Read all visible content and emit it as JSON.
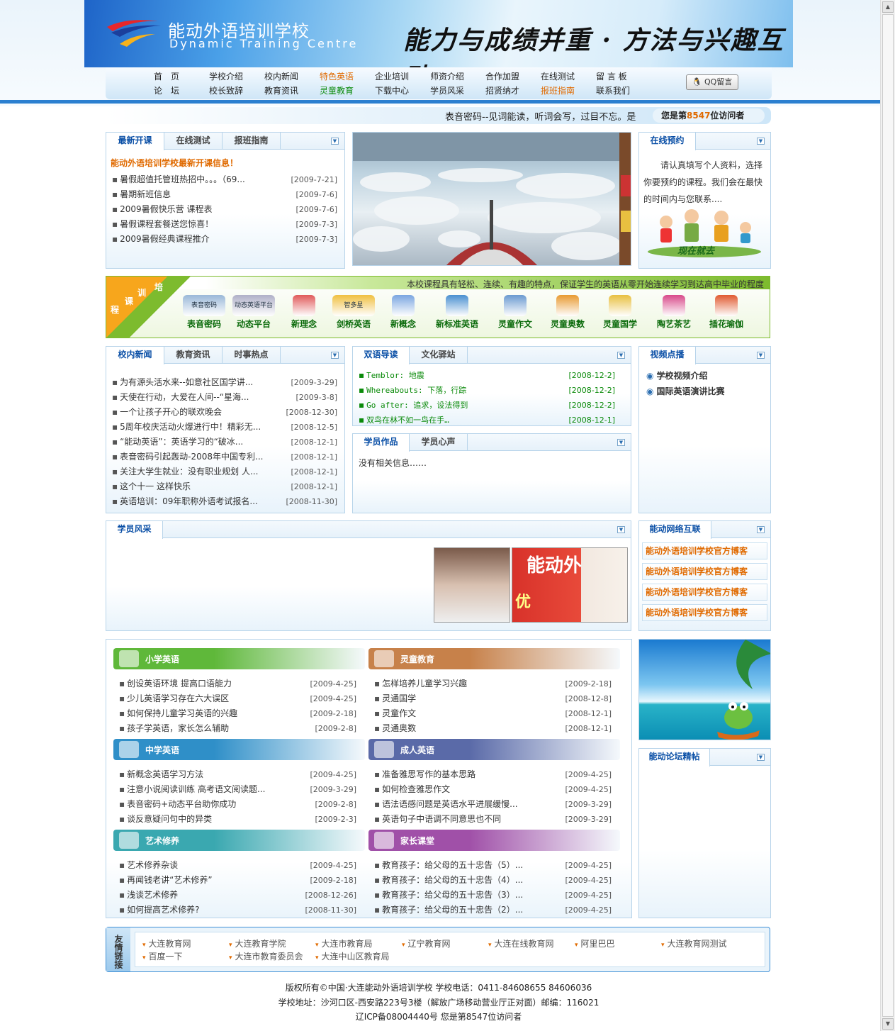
{
  "header": {
    "school_cn": "能动外语培训学校",
    "school_en": "Dynamic Training Centre",
    "slogan": "能力与成绩并重 · 方法与兴趣互动"
  },
  "nav": {
    "row1": [
      "首　页",
      "学校介绍",
      "校内新闻",
      "特色英语",
      "企业培训",
      "师资介绍",
      "合作加盟",
      "在线测试",
      "留 言 板"
    ],
    "row2": [
      "论　坛",
      "校长致辞",
      "教育资讯",
      "灵童教育",
      "下载中心",
      "学员风采",
      "招贤纳才",
      "报班指南",
      "联系我们"
    ],
    "qq": "QQ留言"
  },
  "ticker": {
    "text": "表音密码--见词能读，听词会写，过目不忘。是",
    "visitor_prefix": "您是第",
    "visitor_count": "8547",
    "visitor_suffix": "位访问者"
  },
  "newclass": {
    "tabs": [
      "最新开课",
      "在线测试",
      "报班指南"
    ],
    "headline": "能动外语培训学校最新开课信息！",
    "items": [
      {
        "t": "暑假超值托管班热招中。。。（69...",
        "d": "[2009-7-21]"
      },
      {
        "t": "暑期新班信息",
        "d": "[2009-7-6]"
      },
      {
        "t": "2009暑假快乐营 课程表",
        "d": "[2009-7-6]"
      },
      {
        "t": "暑假课程套餐送您惊喜！",
        "d": "[2009-7-3]"
      },
      {
        "t": "2009暑假经典课程推介",
        "d": "[2009-7-3]"
      }
    ]
  },
  "booking": {
    "tab": "在线预约",
    "text": "请认真填写个人资料，选择你要预约的课程。我们会在最快的时间内与您联系....",
    "img_text": "现在就去"
  },
  "courses": {
    "corner": [
      "培",
      "训",
      "课",
      "程"
    ],
    "desc": "本校课程具有轻松、连续、有趣的特点，保证学生的英语从零开始连续学习到达高中毕业的程度",
    "items": [
      "表音密码",
      "动态平台",
      "新理念",
      "剑桥英语",
      "新概念",
      "新标准英语",
      "灵童作文",
      "灵童奥数",
      "灵童国学",
      "陶艺茶艺",
      "插花瑜伽"
    ],
    "logo_texts": [
      "表音密码",
      "动态英语平台",
      "智多星"
    ]
  },
  "news": {
    "tabs": [
      "校内新闻",
      "教育资讯",
      "时事热点"
    ],
    "items": [
      {
        "t": "为有源头活水来--如意社区国学讲...",
        "d": "[2009-3-29]"
      },
      {
        "t": "天使在行动，大爱在人间--“星海...",
        "d": "[2009-3-8]"
      },
      {
        "t": "一个让孩子开心的联欢晚会",
        "d": "[2008-12-30]"
      },
      {
        "t": "5周年校庆活动火爆进行中！精彩无...",
        "d": "[2008-12-5]"
      },
      {
        "t": "“能动英语”：英语学习的“破冰...",
        "d": "[2008-12-1]"
      },
      {
        "t": "表音密码引起轰动-2008年中国专利...",
        "d": "[2008-12-1]"
      },
      {
        "t": "关注大学生就业：没有职业规划 人...",
        "d": "[2008-12-1]"
      },
      {
        "t": "这个十一 这样快乐",
        "d": "[2008-12-1]"
      },
      {
        "t": "英语培训：09年职称外语考试报名...",
        "d": "[2008-11-30]"
      }
    ]
  },
  "vocab": {
    "tabs": [
      "双语导读",
      "文化驿站"
    ],
    "items": [
      {
        "t": "Temblor: 地震",
        "d": "[2008-12-2]"
      },
      {
        "t": "Whereabouts: 下落，行踪",
        "d": "[2008-12-2]"
      },
      {
        "t": "Go after: 追求，设法得到",
        "d": "[2008-12-2]"
      },
      {
        "t": "双鸟在林不如一鸟在手…",
        "d": "[2008-12-1]"
      }
    ]
  },
  "works": {
    "tabs": [
      "学员作品",
      "学员心声"
    ],
    "empty": "没有相关信息……"
  },
  "video": {
    "tab": "视频点播",
    "items": [
      "学校视频介绍",
      "国际英语演讲比赛"
    ]
  },
  "students": {
    "tab": "学员风采",
    "photo_text": "能动外",
    "photo_text2": "优"
  },
  "network": {
    "tab": "能动网络互联",
    "items": [
      "能动外语培训学校官方博客",
      "能动外语培训学校官方博客",
      "能动外语培训学校官方博客",
      "能动外语培训学校官方博客"
    ]
  },
  "forum": {
    "tab": "能动论坛精帖"
  },
  "sections": [
    {
      "title": "小学英语",
      "color": "#5fb83a",
      "items": [
        {
          "t": "创设英语环境 提高口语能力",
          "d": "[2009-4-25]"
        },
        {
          "t": "少儿英语学习存在六大误区",
          "d": "[2009-4-25]"
        },
        {
          "t": "如何保持儿童学习英语的兴趣",
          "d": "[2009-2-18]"
        },
        {
          "t": "孩子学英语，家长怎么辅助",
          "d": "[2009-2-8]"
        }
      ]
    },
    {
      "title": "灵童教育",
      "color": "#c7814a",
      "items": [
        {
          "t": "怎样培养儿童学习兴趣",
          "d": "[2009-2-18]"
        },
        {
          "t": "灵通国学",
          "d": "[2008-12-8]"
        },
        {
          "t": "灵童作文",
          "d": "[2008-12-1]"
        },
        {
          "t": "灵通奥数",
          "d": "[2008-12-1]"
        }
      ]
    },
    {
      "title": "中学英语",
      "color": "#2f8fc8",
      "items": [
        {
          "t": "新概念英语学习方法",
          "d": "[2009-4-25]"
        },
        {
          "t": "注意小说阅读训练 高考语文阅读题...",
          "d": "[2009-3-29]"
        },
        {
          "t": "表音密码+动态平台助你成功",
          "d": "[2009-2-8]"
        },
        {
          "t": "谈反意疑问句中的异类",
          "d": "[2009-2-3]"
        }
      ]
    },
    {
      "title": "成人英语",
      "color": "#5a6aa8",
      "items": [
        {
          "t": "准备雅思写作的基本思路",
          "d": "[2009-4-25]"
        },
        {
          "t": "如何检查雅思作文",
          "d": "[2009-4-25]"
        },
        {
          "t": "语法语感问题是英语水平进展缓慢...",
          "d": "[2009-3-29]"
        },
        {
          "t": "英语句子中语调不同意思也不同",
          "d": "[2009-3-29]"
        }
      ]
    },
    {
      "title": "艺术修养",
      "color": "#3aa8b0",
      "items": [
        {
          "t": "艺术修养杂谈",
          "d": "[2009-4-25]"
        },
        {
          "t": "再闻钱老讲“艺术修养”",
          "d": "[2009-2-18]"
        },
        {
          "t": "浅谈艺术修养",
          "d": "[2008-12-26]"
        },
        {
          "t": "如何提高艺术修养?",
          "d": "[2008-11-30]"
        }
      ]
    },
    {
      "title": "家长课堂",
      "color": "#a050a8",
      "items": [
        {
          "t": "教育孩子：给父母的五十忠告（5）...",
          "d": "[2009-4-25]"
        },
        {
          "t": "教育孩子：给父母的五十忠告（4）...",
          "d": "[2009-4-25]"
        },
        {
          "t": "教育孩子：给父母的五十忠告（3）...",
          "d": "[2009-4-25]"
        },
        {
          "t": "教育孩子：给父母的五十忠告（2）...",
          "d": "[2009-4-25]"
        }
      ]
    }
  ],
  "friend_links": {
    "label": "友情链接",
    "items": [
      "大连教育网",
      "大连教育学院",
      "大连市教育局",
      "辽宁教育网",
      "大连在线教育网",
      "阿里巴巴",
      "大连教育网测试",
      "百度一下",
      "大连市教育委员会",
      "大连中山区教育局"
    ]
  },
  "footer": {
    "line1": "版权所有©中国·大连能动外语培训学校  学校电话：0411-84608655 84606036",
    "line2": "学校地址：沙河口区-西安路223号3楼（解放广场移动营业厅正对面）邮编：116021",
    "line3": "辽ICP备08004440号  您是第8547位访问者"
  }
}
